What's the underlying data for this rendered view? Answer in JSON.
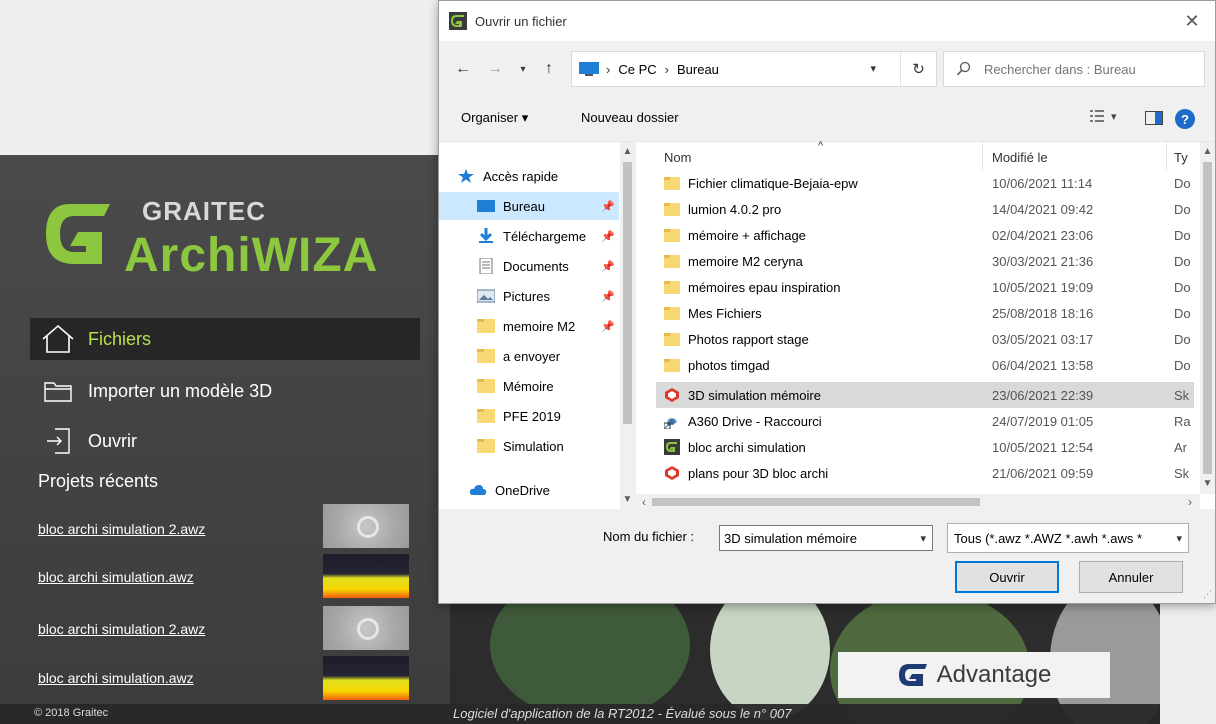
{
  "app": {
    "brand_top": "GRAITEC",
    "brand_main": "ArchiWIZA",
    "nav": [
      {
        "label": "Fichiers"
      },
      {
        "label": "Importer un modèle 3D"
      },
      {
        "label": "Ouvrir"
      }
    ],
    "recent_title": "Projets récents",
    "recent": [
      {
        "label": "bloc archi simulation 2.awz"
      },
      {
        "label": "bloc archi simulation.awz"
      },
      {
        "label": "bloc archi simulation 2.awz"
      },
      {
        "label": "bloc archi simulation.awz"
      }
    ],
    "copyright": "© 2018 Graitec",
    "footer_note": "Logiciel d'application de la RT2012 - Évalué sous le n° 007",
    "advantage_label": "Advantage",
    "accent_color": "#8dc63f"
  },
  "dialog": {
    "title": "Ouvrir un fichier",
    "address": {
      "root": "Ce PC",
      "folder": "Bureau"
    },
    "search_placeholder": "Rechercher dans : Bureau",
    "toolbar": {
      "organize": "Organiser ▾",
      "new_folder": "Nouveau dossier"
    },
    "nav_items": [
      {
        "label": "Accès rapide",
        "icon": "star-icon"
      },
      {
        "label": "Bureau",
        "icon": "desktop-icon"
      },
      {
        "label": "Téléchargeme",
        "icon": "download-icon"
      },
      {
        "label": "Documents",
        "icon": "document-icon"
      },
      {
        "label": "Pictures",
        "icon": "pictures-icon"
      },
      {
        "label": "memoire M2",
        "icon": "folder-icon"
      },
      {
        "label": "a envoyer",
        "icon": "folder-icon"
      },
      {
        "label": "Mémoire",
        "icon": "folder-icon"
      },
      {
        "label": "PFE 2019",
        "icon": "folder-icon"
      },
      {
        "label": "Simulation",
        "icon": "folder-icon"
      },
      {
        "label": "OneDrive",
        "icon": "cloud-icon"
      }
    ],
    "columns": {
      "name": "Nom",
      "modified": "Modifié le",
      "type": "Ty"
    },
    "files": [
      {
        "name": "Fichier climatique-Bejaia-epw",
        "date": "10/06/2021 11:14",
        "type": "Do",
        "icon": "folder-icon"
      },
      {
        "name": "lumion 4.0.2 pro",
        "date": "14/04/2021 09:42",
        "type": "Do",
        "icon": "folder-icon"
      },
      {
        "name": "mémoire + affichage",
        "date": "02/04/2021 23:06",
        "type": "Do",
        "icon": "folder-icon"
      },
      {
        "name": "memoire M2 ceryna",
        "date": "30/03/2021 21:36",
        "type": "Do",
        "icon": "folder-icon"
      },
      {
        "name": "mémoires epau inspiration",
        "date": "10/05/2021 19:09",
        "type": "Do",
        "icon": "folder-icon"
      },
      {
        "name": "Mes Fichiers",
        "date": "25/08/2018 18:16",
        "type": "Do",
        "icon": "folder-icon"
      },
      {
        "name": "Photos rapport stage",
        "date": "03/05/2021 03:17",
        "type": "Do",
        "icon": "folder-icon"
      },
      {
        "name": "photos timgad",
        "date": "06/04/2021 13:58",
        "type": "Do",
        "icon": "folder-icon"
      },
      {
        "name": "3D simulation mémoire",
        "date": "23/06/2021 22:39",
        "type": "Sk",
        "icon": "sketchup-icon"
      },
      {
        "name": "A360 Drive - Raccourci",
        "date": "24/07/2019 01:05",
        "type": "Ra",
        "icon": "shortcut-icon"
      },
      {
        "name": "bloc archi simulation",
        "date": "10/05/2021 12:54",
        "type": "Ar",
        "icon": "archiwizard-icon"
      },
      {
        "name": "plans pour 3D bloc archi",
        "date": "21/06/2021 09:59",
        "type": "Sk",
        "icon": "sketchup-icon"
      }
    ],
    "filename_label": "Nom du fichier :",
    "filename_value": "3D simulation mémoire",
    "filetype_value": "Tous (*.awz *.AWZ *.awh *.aws *",
    "open_label": "Ouvrir",
    "cancel_label": "Annuler"
  }
}
